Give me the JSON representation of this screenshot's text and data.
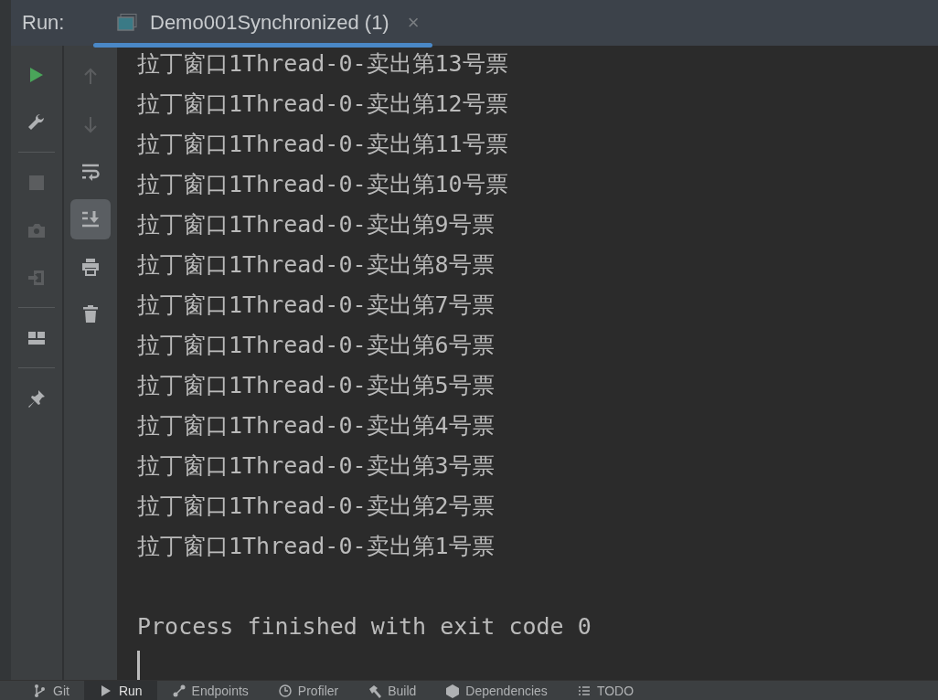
{
  "run_panel": {
    "label": "Run:",
    "tabs": [
      {
        "label": "Demo001Synchronized (1)",
        "selected": true,
        "close_label": "×"
      }
    ]
  },
  "toolbar_primary": [
    {
      "kind": "run",
      "disabled": false
    },
    {
      "kind": "settings",
      "disabled": false
    },
    {
      "kind": "separator"
    },
    {
      "kind": "stop",
      "disabled": true
    },
    {
      "kind": "camera",
      "disabled": true
    },
    {
      "kind": "exit",
      "disabled": true
    },
    {
      "kind": "separator"
    },
    {
      "kind": "layout",
      "disabled": false
    },
    {
      "kind": "separator"
    },
    {
      "kind": "pin",
      "disabled": false
    }
  ],
  "toolbar_secondary": [
    {
      "kind": "up",
      "disabled": true,
      "on": false
    },
    {
      "kind": "down",
      "disabled": true,
      "on": false
    },
    {
      "kind": "wrap",
      "disabled": false,
      "on": false
    },
    {
      "kind": "scroll-end",
      "disabled": false,
      "on": true
    },
    {
      "kind": "print",
      "disabled": false,
      "on": false
    },
    {
      "kind": "trash",
      "disabled": false,
      "on": false
    }
  ],
  "console": {
    "lines": [
      "拉丁窗口1Thread-0-卖出第13号票",
      "拉丁窗口1Thread-0-卖出第12号票",
      "拉丁窗口1Thread-0-卖出第11号票",
      "拉丁窗口1Thread-0-卖出第10号票",
      "拉丁窗口1Thread-0-卖出第9号票",
      "拉丁窗口1Thread-0-卖出第8号票",
      "拉丁窗口1Thread-0-卖出第7号票",
      "拉丁窗口1Thread-0-卖出第6号票",
      "拉丁窗口1Thread-0-卖出第5号票",
      "拉丁窗口1Thread-0-卖出第4号票",
      "拉丁窗口1Thread-0-卖出第3号票",
      "拉丁窗口1Thread-0-卖出第2号票",
      "拉丁窗口1Thread-0-卖出第1号票"
    ],
    "exit_message": "Process finished with exit code 0",
    "cursor": true
  },
  "bottom_tabs": [
    {
      "label": "Git",
      "kind": "branch",
      "selected": false
    },
    {
      "label": "Run",
      "kind": "play",
      "selected": true
    },
    {
      "label": "Endpoints",
      "kind": "endpoints",
      "selected": false
    },
    {
      "label": "Profiler",
      "kind": "clock",
      "selected": false
    },
    {
      "label": "Build",
      "kind": "hammer",
      "selected": false
    },
    {
      "label": "Dependencies",
      "kind": "cube",
      "selected": false
    },
    {
      "label": "TODO",
      "kind": "list",
      "selected": false
    }
  ]
}
